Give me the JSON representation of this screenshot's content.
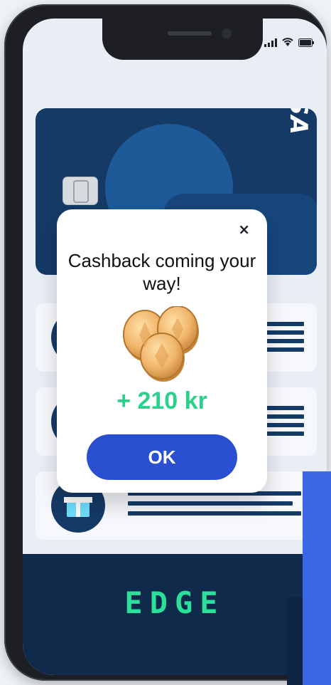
{
  "modal": {
    "title": "Cashback coming your way!",
    "amount": "+ 210 kr",
    "ok_label": "OK",
    "close_label": "×"
  },
  "card": {
    "brand": "VISA"
  },
  "footer": {
    "logo_text": "EDGE"
  },
  "colors": {
    "card": "#153a66",
    "accent_green": "#2bd18b",
    "ok_button": "#2a4fd1",
    "footer": "#0f2a4b"
  }
}
